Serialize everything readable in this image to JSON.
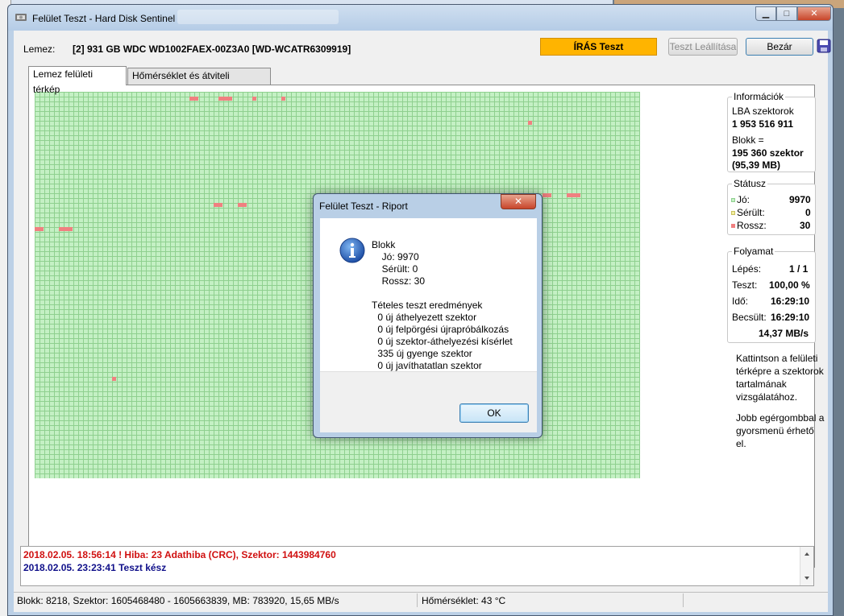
{
  "window": {
    "title": "Felület Teszt - Hard Disk Sentinel",
    "buttons": {
      "minimize": "▁",
      "maximize": "□",
      "close": "✕"
    }
  },
  "toolbar": {
    "disk_label": "Lemez:",
    "disk_value": "[2] 931 GB  WDC WD1002FAEX-00Z3A0 [WD-WCATR6309919]",
    "write_test": "ÍRÁS Teszt",
    "stop_button": "Teszt Leállítása",
    "close_button": "Bezár",
    "save_icon": "floppy-disk-icon"
  },
  "tabs": [
    {
      "label": "Lemez felületi térkép",
      "active": true
    },
    {
      "label": "Hőmérséklet és átviteli sebesség",
      "active": false
    }
  ],
  "sector_map": {
    "cell_color": "#c4f0c4",
    "bad_color": "#f08080"
  },
  "info": {
    "title": "Információk",
    "lba_label": "LBA szektorok",
    "lba_value": "1 953 516 911",
    "block_label": "Blokk =",
    "block_value": "195 360 szektor",
    "block_mb": "(95,39 MB)"
  },
  "status_group": {
    "title": "Státusz",
    "good_label": "Jó:",
    "good_value": "9970",
    "damaged_label": "Sérült:",
    "damaged_value": "0",
    "bad_label": "Rossz:",
    "bad_value": "30"
  },
  "progress": {
    "title": "Folyamat",
    "step_label": "Lépés:",
    "step_value": "1 / 1",
    "test_label": "Teszt:",
    "test_value": "100,00 %",
    "time_label": "Idő:",
    "time_value": "16:29:10",
    "est_label": "Becsült:",
    "est_value": "16:29:10",
    "speed": "14,37 MB/s"
  },
  "help": {
    "line1": "Kattintson a felületi",
    "line2": "térképre a szektorok",
    "line3": "tartalmának",
    "line4": "vizsgálatához.",
    "line5": "Jobb egérgombbal a",
    "line6": "gyorsmenü érhető",
    "line7": "el."
  },
  "log": [
    {
      "text": "2018.02.05.  18:56:14 ! Hiba: 23 Adathiba (CRC), Szektor: 1443984760",
      "color": "#d01010"
    },
    {
      "text": "2018.02.05.  23:23:41   Teszt kész",
      "color": "#10108a"
    }
  ],
  "statusbar": {
    "left": "Blokk: 8218, Szektor: 1605468480 - 1605663839, MB: 783920, 15,65 MB/s",
    "temp": "Hőmérséklet: 43  °C"
  },
  "dialog": {
    "title": "Felület Teszt - Riport",
    "close": "✕",
    "icon": "info-icon",
    "lines": [
      "Blokk",
      "  Jó: 9970",
      "  Sérült: 0",
      "  Rossz: 30",
      "Tételes teszt eredmények",
      " 0 új áthelyezett szektor",
      " 0 új felpörgési újrapróbálkozás",
      " 0 új szektor-áthelyezési kísérlet",
      " 335 új gyenge szektor",
      " 0 új javíthatatlan szektor"
    ],
    "ok_button": "OK"
  }
}
